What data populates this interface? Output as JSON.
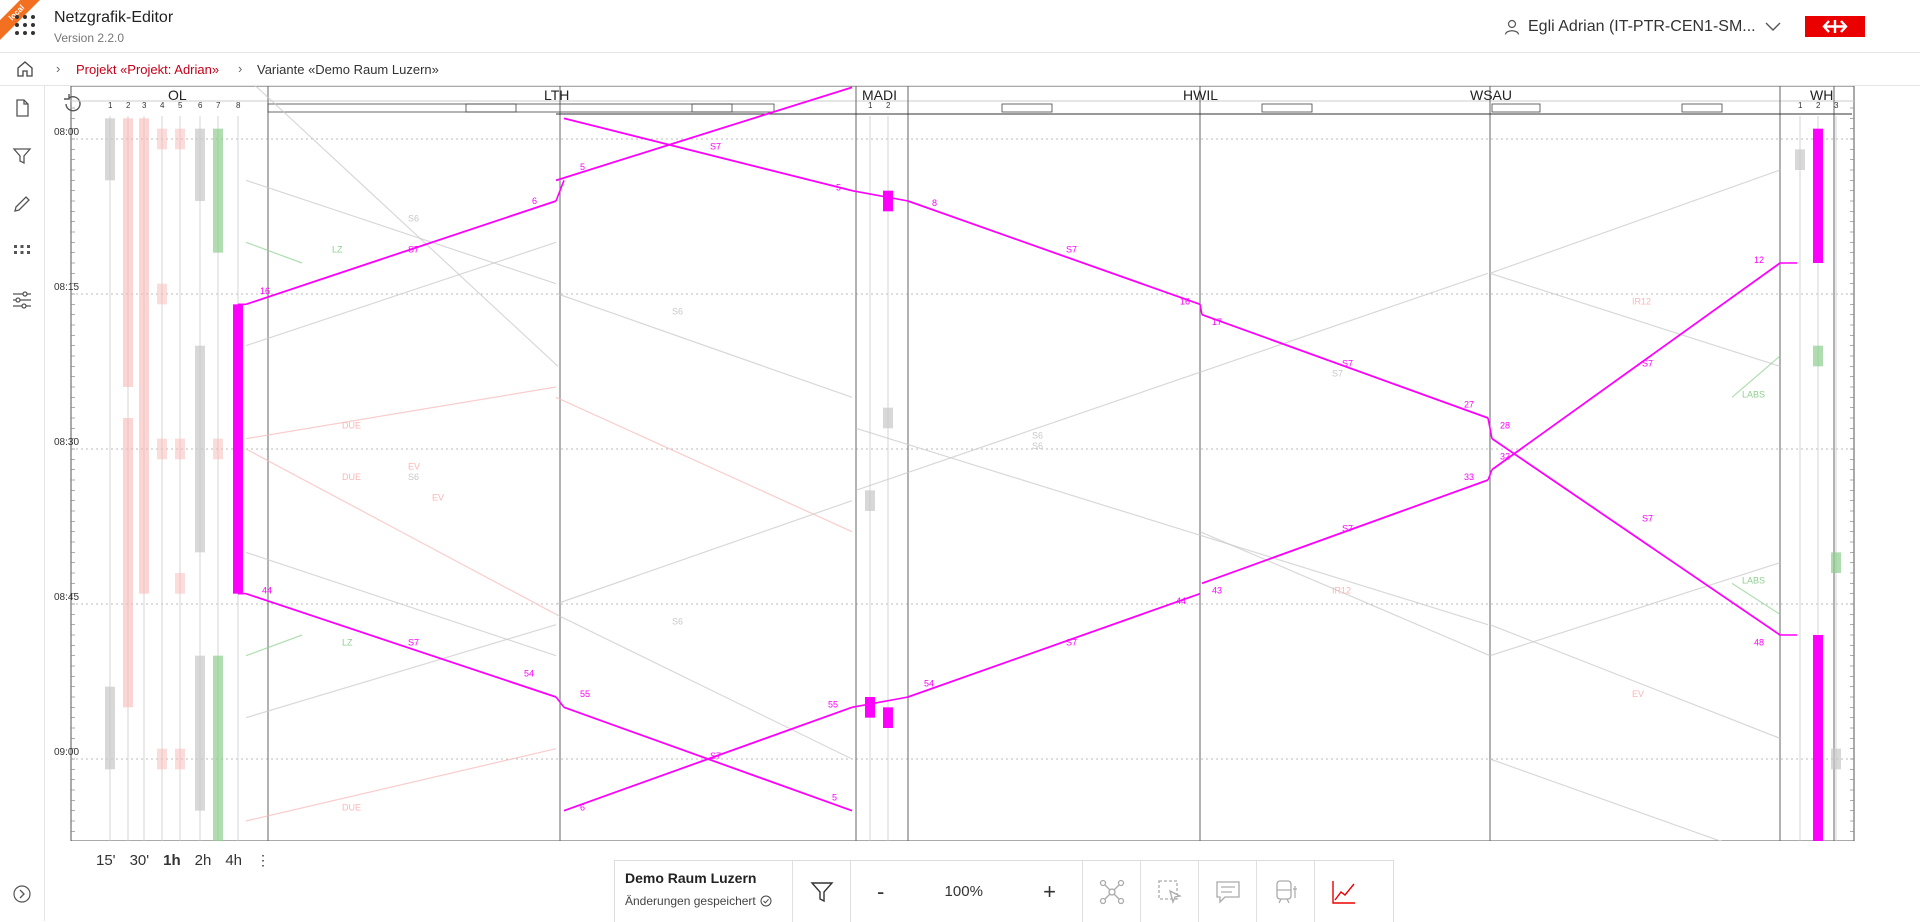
{
  "header": {
    "badge": "local",
    "title": "Netzgrafik-Editor",
    "version": "Version 2.2.0",
    "user": "Egli Adrian (IT-PTR-CEN1-SM..."
  },
  "breadcrumb": {
    "project": "Projekt «Projekt: Adrian»",
    "variant": "Variante «Demo Raum Luzern»"
  },
  "colors": {
    "accent": "#ff00ff",
    "brand": "#eb0000",
    "link": "#c60018",
    "faded_red": "#f9b7b7",
    "faded_green": "#8fcf8f",
    "faded_gray": "#c8c8c8"
  },
  "stations": [
    {
      "name": "OL",
      "tracks": [
        "1",
        "2",
        "3",
        "4",
        "5",
        "6",
        "7",
        "8"
      ]
    },
    {
      "name": "LTH",
      "tracks": []
    },
    {
      "name": "MADI",
      "tracks": [
        "1",
        "2"
      ]
    },
    {
      "name": "HWIL",
      "tracks": []
    },
    {
      "name": "WSAU",
      "tracks": []
    },
    {
      "name": "WH",
      "tracks": [
        "1",
        "2",
        "3"
      ]
    }
  ],
  "time_labels": [
    "08:00",
    "08:15",
    "08:30",
    "08:45",
    "09:00"
  ],
  "train_labels": {
    "main": "S7",
    "faded": [
      "S6",
      "S6",
      "S6",
      "S6",
      "S6",
      "S6",
      "S7",
      "IR12",
      "IR12",
      "EV",
      "EV",
      "EV",
      "LZ",
      "LZ",
      "DUE",
      "DUE",
      "DUE",
      "LABS",
      "LABS"
    ]
  },
  "minute_labels": [
    "16",
    "6",
    "5",
    "5",
    "8",
    "16",
    "17",
    "27",
    "28",
    "32",
    "33",
    "43",
    "44",
    "54",
    "55",
    "54",
    "55",
    "5",
    "6",
    "12",
    "48",
    "44"
  ],
  "timescale": [
    "15'",
    "30'",
    "1h",
    "2h",
    "4h"
  ],
  "timescale_active": "1h",
  "toolbar": {
    "project_name": "Demo Raum Luzern",
    "saved": "Änderungen gespeichert",
    "zoom_out": "-",
    "zoom": "100%",
    "zoom_in": "+"
  }
}
